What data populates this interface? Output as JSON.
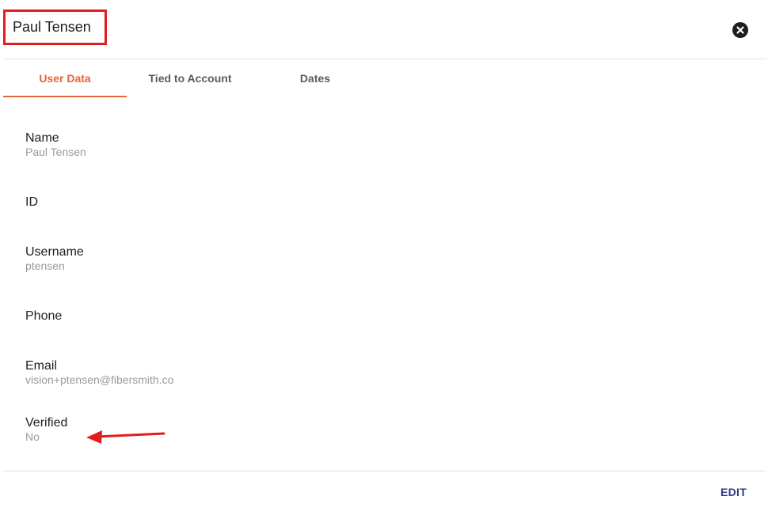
{
  "header": {
    "title": "Paul Tensen",
    "close_icon": "close-icon"
  },
  "tabs": [
    {
      "label": "User Data",
      "active": true
    },
    {
      "label": "Tied to Account",
      "active": false
    },
    {
      "label": "Dates",
      "active": false
    }
  ],
  "fields": {
    "name": {
      "label": "Name",
      "value": "Paul Tensen"
    },
    "id": {
      "label": "ID",
      "value": ""
    },
    "username": {
      "label": "Username",
      "value": "ptensen"
    },
    "phone": {
      "label": "Phone",
      "value": ""
    },
    "email": {
      "label": "Email",
      "value": "vision+ptensen@fibersmith.co"
    },
    "verified": {
      "label": "Verified",
      "value": "No"
    }
  },
  "footer": {
    "edit_label": "EDIT"
  },
  "colors": {
    "accent": "#e8643a",
    "annotation": "#e31d1d",
    "edit": "#2f3a8a"
  }
}
